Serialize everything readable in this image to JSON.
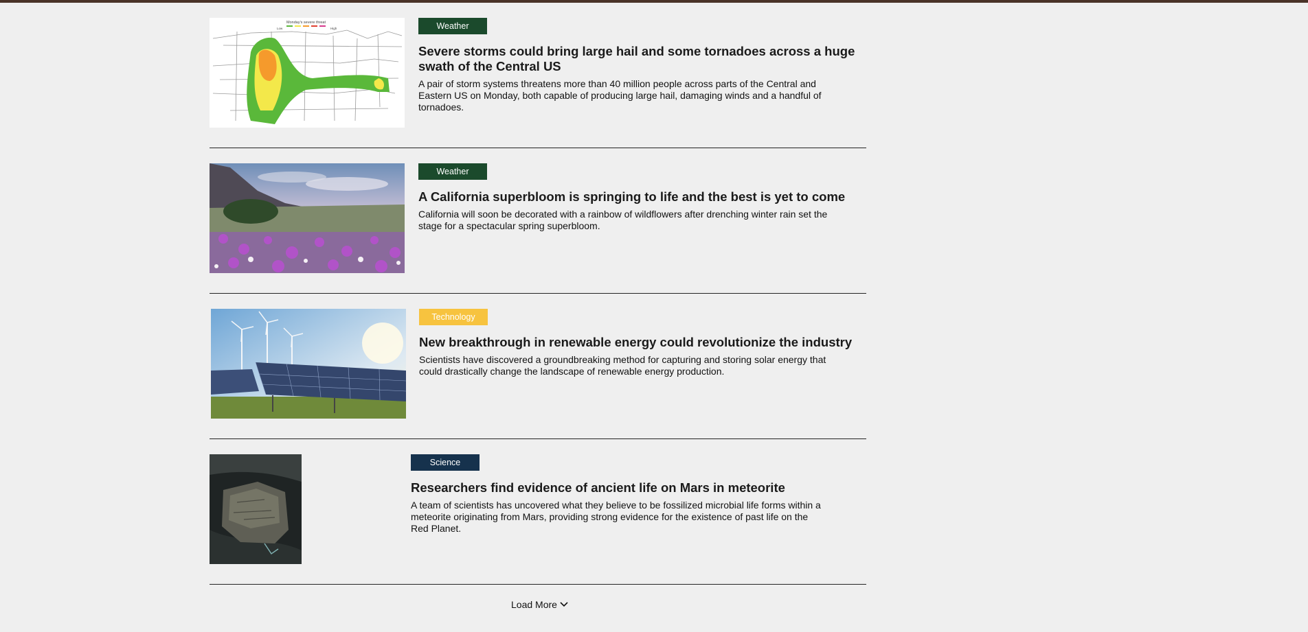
{
  "articles": [
    {
      "category": "Weather",
      "headline": "Severe storms could bring large hail and some tornadoes across a huge swath of the Central US",
      "summary": "A pair of storm systems threatens more than 40 million people across parts of the Central and Eastern US on Monday, both capable of producing large hail, damaging winds and a handful of tornadoes.",
      "map_title": "Monday's severe threat",
      "map_low": "Low",
      "map_high": "High"
    },
    {
      "category": "Weather",
      "headline": "A California superbloom is springing to life and the best is yet to come",
      "summary": "California will soon be decorated with a rainbow of wildflowers after drenching winter rain set the stage for a spectacular spring superbloom."
    },
    {
      "category": "Technology",
      "headline": "New breakthrough in renewable energy could revolutionize the industry",
      "summary": "Scientists have discovered a groundbreaking method for capturing and storing solar energy that could drastically change the landscape of renewable energy production."
    },
    {
      "category": "Science",
      "headline": "Researchers find evidence of ancient life on Mars in meteorite",
      "summary": "A team of scientists has uncovered what they believe to be fossilized microbial life forms within a meteorite originating from Mars, providing strong evidence for the existence of past life on the Red Planet."
    }
  ],
  "load_more": {
    "label": "Load More",
    "icon": "chevron-down-icon"
  },
  "colors": {
    "top_bar": "#4a3328",
    "weather_badge": "#1b4a2c",
    "technology_badge": "#f7c33f",
    "science_badge": "#16324d",
    "background": "#efefef"
  }
}
